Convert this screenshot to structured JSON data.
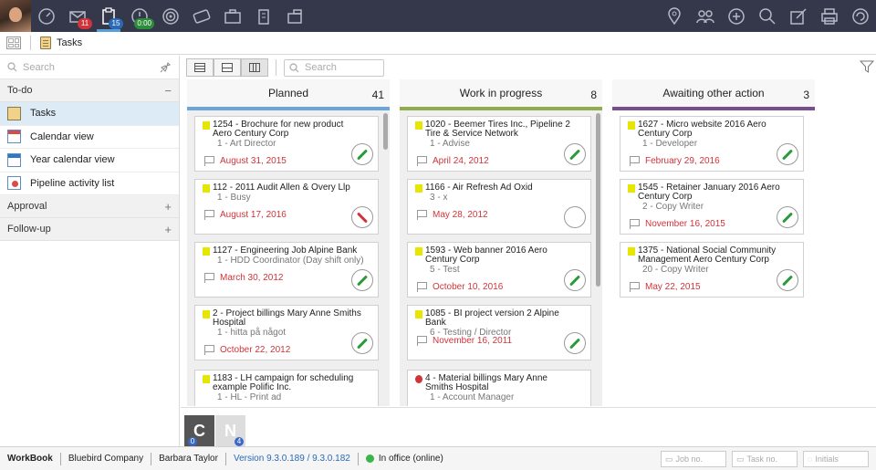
{
  "topbar": {
    "badges": {
      "mail": "11",
      "tasks": "15",
      "timer": "0:00"
    },
    "colors": {
      "bg": "#34384a",
      "active": "#5c9ed8"
    }
  },
  "subbar": {
    "title": "Tasks"
  },
  "sidebar": {
    "search_placeholder": "Search",
    "sections": [
      {
        "label": "To-do",
        "toggle": "−"
      },
      {
        "label": "Approval",
        "toggle": "+"
      },
      {
        "label": "Follow-up",
        "toggle": "+"
      }
    ],
    "items": [
      {
        "label": "Tasks"
      },
      {
        "label": "Calendar view"
      },
      {
        "label": "Year calendar view"
      },
      {
        "label": "Pipeline activity list"
      }
    ]
  },
  "toolbar": {
    "search_placeholder": "Search"
  },
  "columns": [
    {
      "title": "Planned",
      "count": "41",
      "color": "#6aa6dc",
      "cards": [
        {
          "title": "1254 - Brochure for new product Aero Century Corp",
          "sub": "1 - Art Director",
          "date": "August 31, 2015",
          "gauge": "green"
        },
        {
          "title": "112 - 2011 Audit Allen & Overy Llp",
          "sub": "1 - Busy",
          "date": "August 17, 2016",
          "gauge": "red"
        },
        {
          "title": "1127 - Engineering Job Alpine Bank",
          "sub": "1 - HDD Coordinator (Day shift only)",
          "date": "March 30, 2012",
          "gauge": "green"
        },
        {
          "title": "2 - Project billings Mary Anne Smiths Hospital",
          "sub": "1 - hitta på något",
          "date": "October 22, 2012",
          "gauge": "green"
        },
        {
          "title": "1183 - LH campaign for scheduling example Polific Inc.",
          "sub": "1 - HL - Print ad",
          "date": "",
          "gauge": "none"
        }
      ]
    },
    {
      "title": "Work in progress",
      "count": "8",
      "color": "#8fad4e",
      "cards": [
        {
          "title": "1020 - Beemer Tires Inc., Pipeline 2 Tire & Service Network",
          "sub": "1 - Advise",
          "date": "April 24, 2012",
          "gauge": "green"
        },
        {
          "title": "1166 - Air Refresh Ad Oxid",
          "sub": "3 - x",
          "date": "May 28, 2012",
          "gauge": "empty"
        },
        {
          "title": "1593 - Web banner 2016 Aero Century Corp",
          "sub": "5 - Test",
          "date": "October 10, 2016",
          "gauge": "green"
        },
        {
          "title": "1085 - BI project version 2 Alpine Bank",
          "sub": "6 - Testing / Director",
          "date": "November 16, 2011",
          "gauge": "green"
        },
        {
          "title": "4 - Material billings Mary Anne Smiths Hospital",
          "sub": "1 - Account Manager",
          "date": "",
          "gauge": "none"
        }
      ]
    },
    {
      "title": "Awaiting other action",
      "count": "3",
      "color": "#7a4e8c",
      "cards": [
        {
          "title": "1627 - Micro website 2016 Aero Century Corp",
          "sub": "1 - Developer",
          "date": "February 29, 2016",
          "gauge": "green"
        },
        {
          "title": "1545 - Retainer January 2016 Aero Century Corp",
          "sub": "2 - Copy Writer",
          "date": "November 16, 2015",
          "gauge": "green"
        },
        {
          "title": "1375 - National Social Community Management Aero Century Corp",
          "sub": "20 - Copy Writer",
          "date": "May 22, 2015",
          "gauge": "green"
        }
      ]
    }
  ],
  "pods": [
    {
      "letter": "C",
      "count": "0"
    },
    {
      "letter": "N",
      "count": "4"
    }
  ],
  "status": {
    "brand": "WorkBook",
    "company": "Bluebird Company",
    "user": "Barbara Taylor",
    "version": "Version 9.3.0.189 / 9.3.0.182",
    "presence": "In office (online)",
    "job_placeholder": "Job no.",
    "task_placeholder": "Task no.",
    "initials_placeholder": "Initials"
  }
}
